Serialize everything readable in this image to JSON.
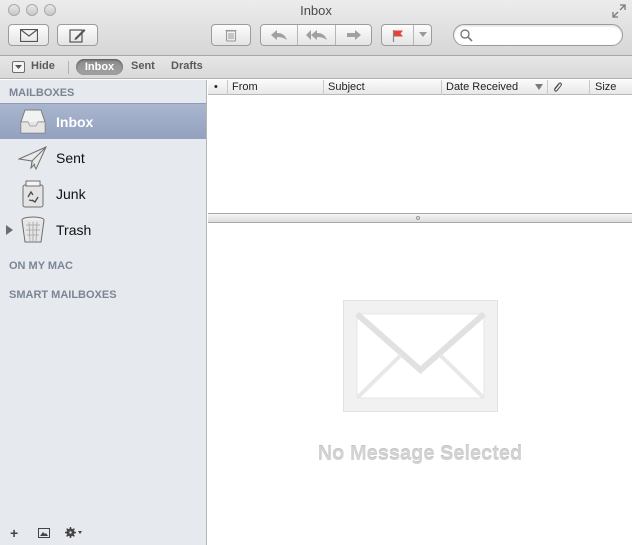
{
  "window": {
    "title": "Inbox"
  },
  "toolbar": {
    "get_mail_icon": "envelope-icon",
    "compose_icon": "compose-icon",
    "delete_icon": "trash-icon",
    "reply_icon": "reply-icon",
    "reply_all_icon": "reply-all-icon",
    "forward_icon": "forward-icon",
    "flag_icon": "flag-icon",
    "flag_color": "#e0453a",
    "search_placeholder": ""
  },
  "favorites": {
    "hide_label": "Hide",
    "items": [
      "Inbox",
      "Sent",
      "Drafts"
    ],
    "active": "Inbox"
  },
  "sidebar": {
    "sections": {
      "mailboxes": "MAILBOXES",
      "on_my_mac": "ON MY MAC",
      "smart_mailboxes": "SMART MAILBOXES"
    },
    "mailboxes": [
      {
        "label": "Inbox",
        "icon": "inbox-icon",
        "selected": true
      },
      {
        "label": "Sent",
        "icon": "paper-plane-icon",
        "selected": false
      },
      {
        "label": "Junk",
        "icon": "junk-bin-icon",
        "selected": false
      },
      {
        "label": "Trash",
        "icon": "trash-can-icon",
        "selected": false
      }
    ],
    "footer": {
      "add": "+",
      "show_hide_icon": "photo-browser-icon",
      "action_icon": "gear-icon"
    },
    "selection_color": "#9aa7c4"
  },
  "message_list": {
    "columns": [
      "From",
      "Subject",
      "Date Received",
      "Size"
    ],
    "sort_column": "Date Received",
    "unread_marker": "•",
    "rows": []
  },
  "preview": {
    "empty_text": "No Message Selected",
    "empty_icon": "envelope-large-icon"
  }
}
